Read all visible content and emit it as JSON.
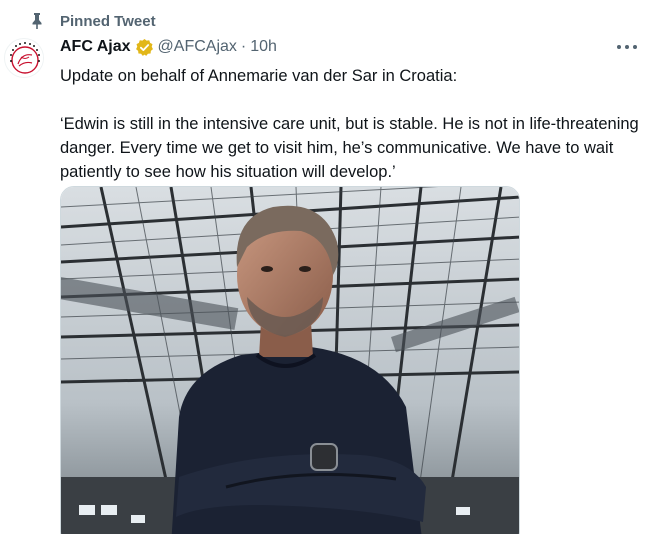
{
  "pinned": {
    "label": "Pinned Tweet",
    "icon": "pin-icon"
  },
  "author": {
    "display_name": "AFC Ajax",
    "handle": "@AFCAjax",
    "separator": "·",
    "time": "10h",
    "verified_icon": "verified-badge-icon",
    "verified_color": "#e2b719",
    "avatar_icon": "ajax-logo"
  },
  "actions": {
    "more_icon": "more-options-icon"
  },
  "tweet": {
    "line1": "Update on behalf of Annemarie van der Sar in Croatia:",
    "quote": "‘Edwin is still in the intensive care unit, but is stable. He is not in life-threatening danger. Every time we get to visit him, he’s communicative. We have to wait patiently to see how his situation will develop.’"
  },
  "media": {
    "type": "photo"
  },
  "colors": {
    "text": "#0f1419",
    "secondary": "#536471",
    "border": "#cfd9de"
  }
}
